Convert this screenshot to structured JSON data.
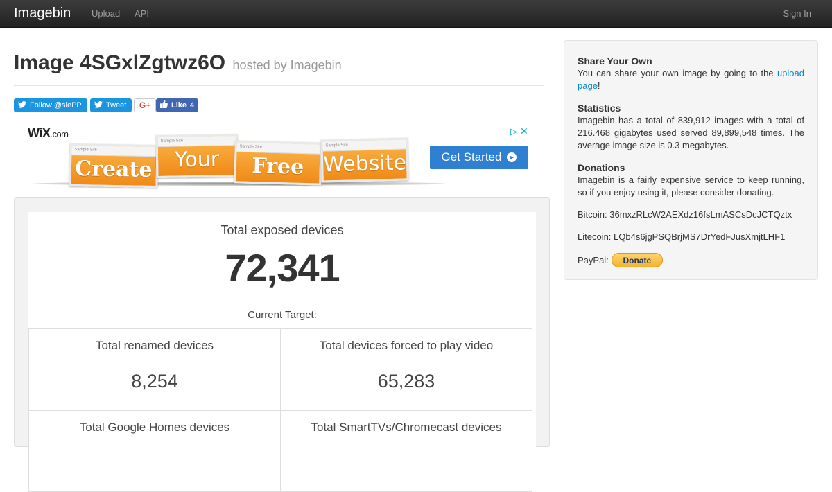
{
  "navbar": {
    "brand": "Imagebin",
    "links": [
      "Upload",
      "API"
    ],
    "signin": "Sign In"
  },
  "header": {
    "title": "Image 4SGxlZgtwz6O",
    "subtitle": "hosted by Imagebin"
  },
  "social": {
    "follow": "Follow @slePP",
    "tweet": "Tweet",
    "gplus": "G+",
    "like": "Like",
    "like_count": "4"
  },
  "ad": {
    "brand": "WiX",
    "brand_suffix": ".com",
    "card_caption": "Sample Site",
    "words": [
      "Create",
      "Your",
      "Free",
      "Website"
    ],
    "cta": "Get Started"
  },
  "hosted_image": {
    "total_label": "Total exposed devices",
    "total_value": "72,341",
    "target_label": "Current Target:",
    "stats": [
      {
        "label": "Total renamed devices",
        "value": "8,254"
      },
      {
        "label": "Total devices forced to play video",
        "value": "65,283"
      },
      {
        "label": "Total Google Homes devices",
        "value": ""
      },
      {
        "label": "Total SmartTVs/Chromecast devices",
        "value": ""
      }
    ]
  },
  "sidebar": {
    "share_heading": "Share Your Own",
    "share_text": "You can share your own image by going to the ",
    "share_link": "upload page",
    "share_end": "!",
    "stats_heading": "Statistics",
    "stats_text": "Imagebin has a total of 839,912 images with a total of 216.468 gigabytes used served 89,899,548 times. The average image size is 0.3 megabytes.",
    "donations_heading": "Donations",
    "donations_text": "Imagebin is a fairly expensive service to keep running, so if you enjoy using it, please consider donating.",
    "bitcoin": "Bitcoin: 36mxzRLcW2AEXdz16fsLmASCsDcJCTQztx",
    "litecoin": "Litecoin: LQb4s6jgPSQBrjMS7DrYedFJusXmjtLHF1",
    "paypal_label": "PayPal:",
    "donate_button": "Donate"
  }
}
